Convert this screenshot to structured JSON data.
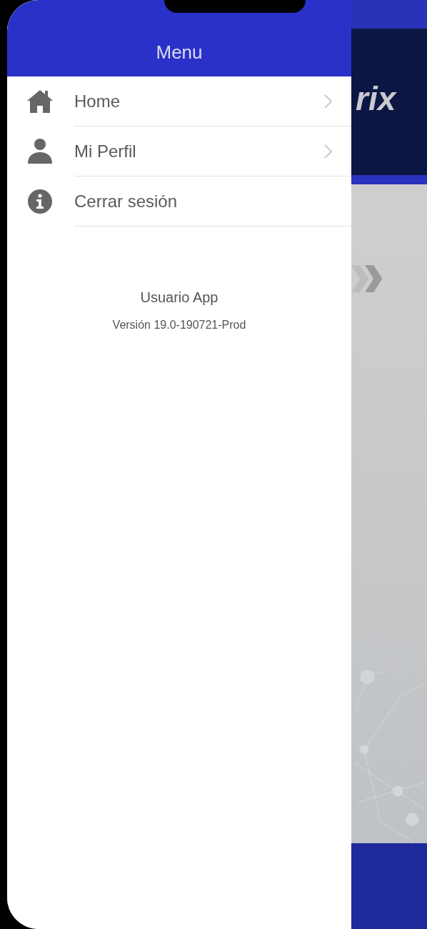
{
  "drawer": {
    "title": "Menu",
    "items": [
      {
        "kind": "home",
        "label": "Home",
        "chevron": true
      },
      {
        "kind": "profile",
        "label": "Mi Perfil",
        "chevron": true
      },
      {
        "kind": "info",
        "label": "Cerrar sesión",
        "chevron": false
      }
    ],
    "user": "Usuario App",
    "version": "Versión 19.0-190721-Prod"
  },
  "background_app": {
    "logo_text": "rix"
  }
}
